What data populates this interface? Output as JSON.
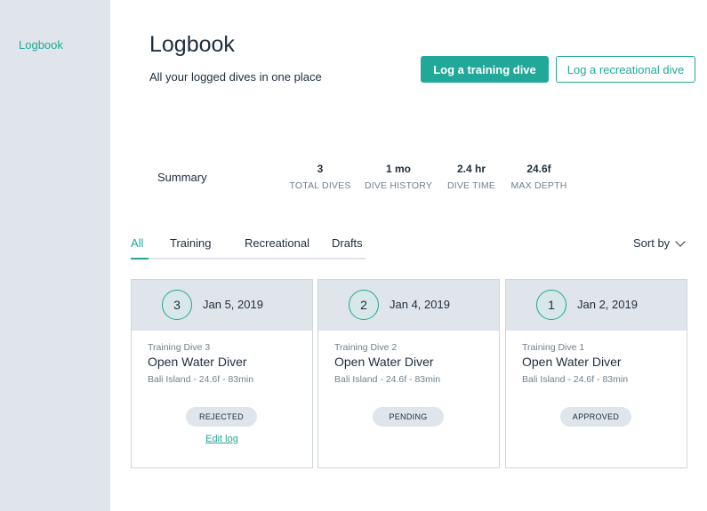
{
  "sidebar": {
    "items": [
      {
        "label": "Logbook"
      }
    ]
  },
  "header": {
    "title": "Logbook",
    "subtitle": "All your logged dives in one place",
    "primary_button": "Log a training dive",
    "secondary_button": "Log a recreational dive"
  },
  "summary": {
    "label": "Summary",
    "stats": [
      {
        "value": "3",
        "label": "TOTAL DIVES"
      },
      {
        "value": "1 mo",
        "label": "DIVE HISTORY"
      },
      {
        "value": "2.4 hr",
        "label": "DIVE TIME"
      },
      {
        "value": "24.6f",
        "label": "MAX DEPTH"
      }
    ]
  },
  "tabs": [
    {
      "label": "All",
      "active": true
    },
    {
      "label": "Training"
    },
    {
      "label": "Recreational"
    },
    {
      "label": "Drafts"
    }
  ],
  "sort": {
    "label": "Sort by"
  },
  "cards": [
    {
      "number": "3",
      "date": "Jan 5, 2019",
      "type": "Training Dive 3",
      "title": "Open Water Diver",
      "meta": "Bali Island - 24.6f - 83min",
      "status": "REJECTED",
      "action": "Edit log"
    },
    {
      "number": "2",
      "date": "Jan 4, 2019",
      "type": "Training Dive 2",
      "title": "Open Water Diver",
      "meta": "Bali Island - 24.6f - 83min",
      "status": "PENDING"
    },
    {
      "number": "1",
      "date": "Jan 2, 2019",
      "type": "Training Dive 1",
      "title": "Open Water Diver",
      "meta": "Bali Island - 24.6f - 83min",
      "status": "APPROVED"
    }
  ],
  "colors": {
    "accent": "#21a898",
    "sidebar_bg": "#dfe5ea",
    "text": "#1f2d3d",
    "muted": "#6e7f8f"
  }
}
